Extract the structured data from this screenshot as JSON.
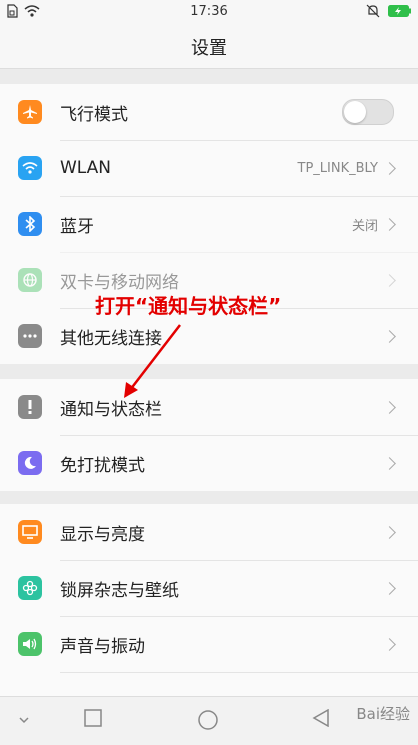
{
  "status_bar": {
    "time": "17:36"
  },
  "header": {
    "title": "设置"
  },
  "groups": [
    {
      "items": [
        {
          "label": "飞行模式",
          "icon": "airplane-icon",
          "color": "#ff8a1f",
          "control": "toggle",
          "toggle_state": "off"
        },
        {
          "label": "WLAN",
          "value": "TP_LINK_BLY",
          "icon": "wifi-icon",
          "color": "#29a3f2"
        },
        {
          "label": "蓝牙",
          "value": "关闭",
          "icon": "bluetooth-icon",
          "color": "#2f8ef0"
        },
        {
          "label": "双卡与移动网络",
          "icon": "globe-icon",
          "color": "#4cc36a",
          "disabled": true
        },
        {
          "label": "其他无线连接",
          "icon": "more-dots-icon",
          "color": "#8a8a8a"
        }
      ]
    },
    {
      "items": [
        {
          "label": "通知与状态栏",
          "icon": "exclamation-icon",
          "color": "#8a8a8a"
        },
        {
          "label": "免打扰模式",
          "icon": "moon-icon",
          "color": "#7b6cf0"
        }
      ]
    },
    {
      "items": [
        {
          "label": "显示与亮度",
          "icon": "monitor-icon",
          "color": "#ff8a1f"
        },
        {
          "label": "锁屏杂志与壁纸",
          "icon": "flower-icon",
          "color": "#2cc3a0"
        },
        {
          "label": "声音与振动",
          "icon": "speaker-icon",
          "color": "#4cc36a"
        }
      ]
    }
  ],
  "annotation": {
    "text": "打开“通知与状态栏”",
    "color": "#e30000"
  },
  "watermark": "Bai经验"
}
